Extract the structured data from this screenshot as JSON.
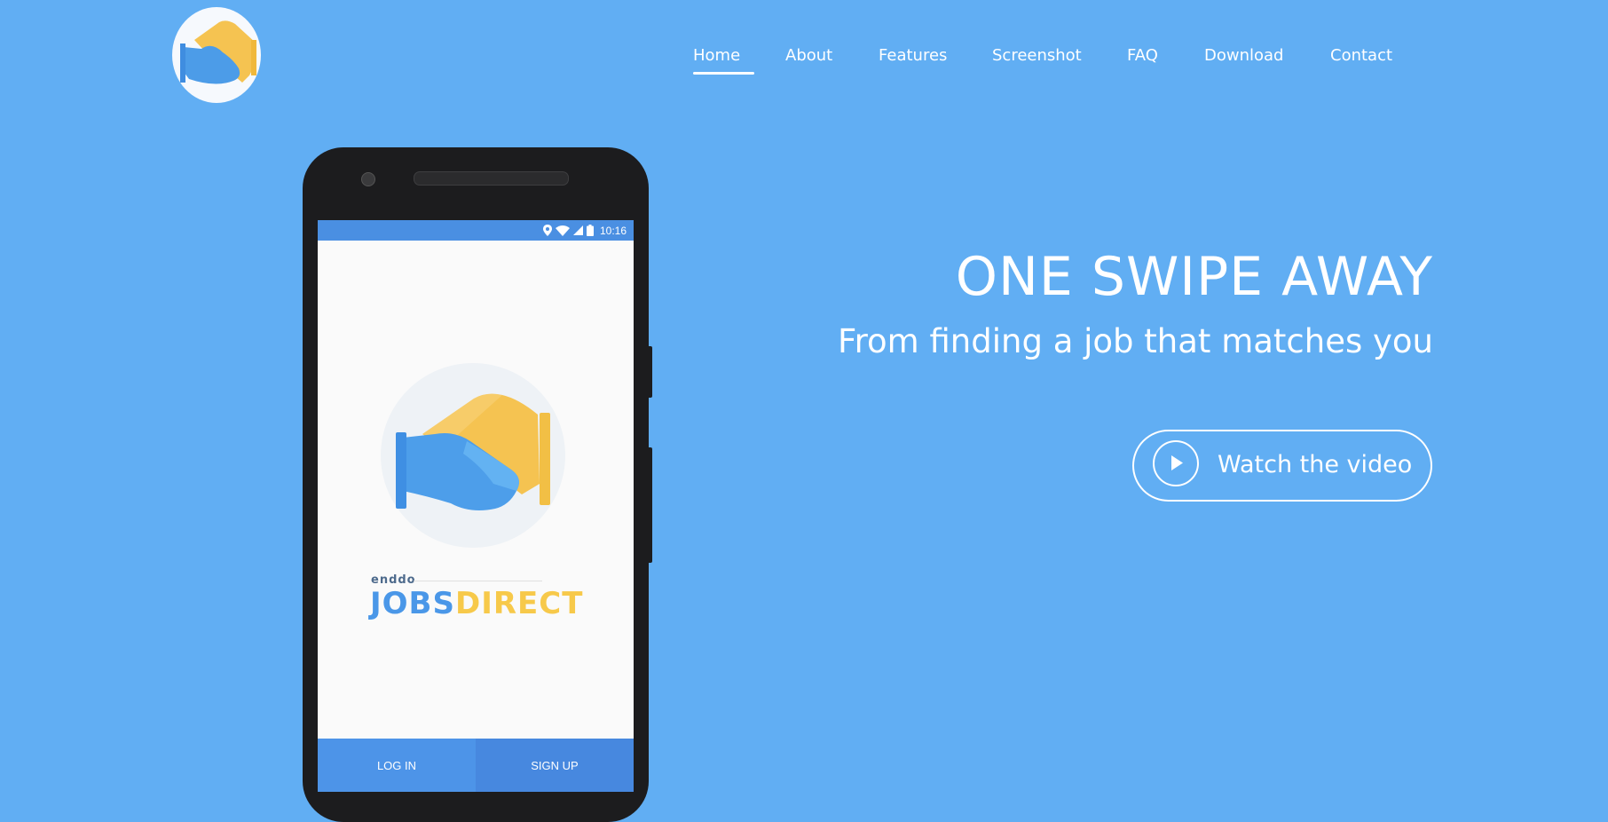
{
  "nav": {
    "items": [
      {
        "label": "Home",
        "active": true
      },
      {
        "label": "About"
      },
      {
        "label": "Features"
      },
      {
        "label": "Screenshot"
      },
      {
        "label": "FAQ"
      },
      {
        "label": "Download"
      },
      {
        "label": "Contact"
      }
    ]
  },
  "hero": {
    "title": "ONE SWIPE AWAY",
    "subtitle": "From finding a job that matches you",
    "video_button": {
      "label": "Watch the video",
      "icon": "play-icon"
    }
  },
  "phone": {
    "status_bar": {
      "time": "10:16",
      "icons": [
        "location-icon",
        "wifi-icon",
        "signal-icon",
        "battery-icon"
      ]
    },
    "app": {
      "brand_sub": "enddo",
      "brand_part1": "JOBS",
      "brand_part2": "DIRECT",
      "login_label": "LOG IN",
      "signup_label": "SIGN UP"
    }
  },
  "colors": {
    "background": "#61aef3",
    "brand_blue": "#4a97e8",
    "brand_yellow": "#f7c94a",
    "status_bar": "#4a8fe2"
  },
  "logo": {
    "icon": "handshake-logo-icon"
  }
}
